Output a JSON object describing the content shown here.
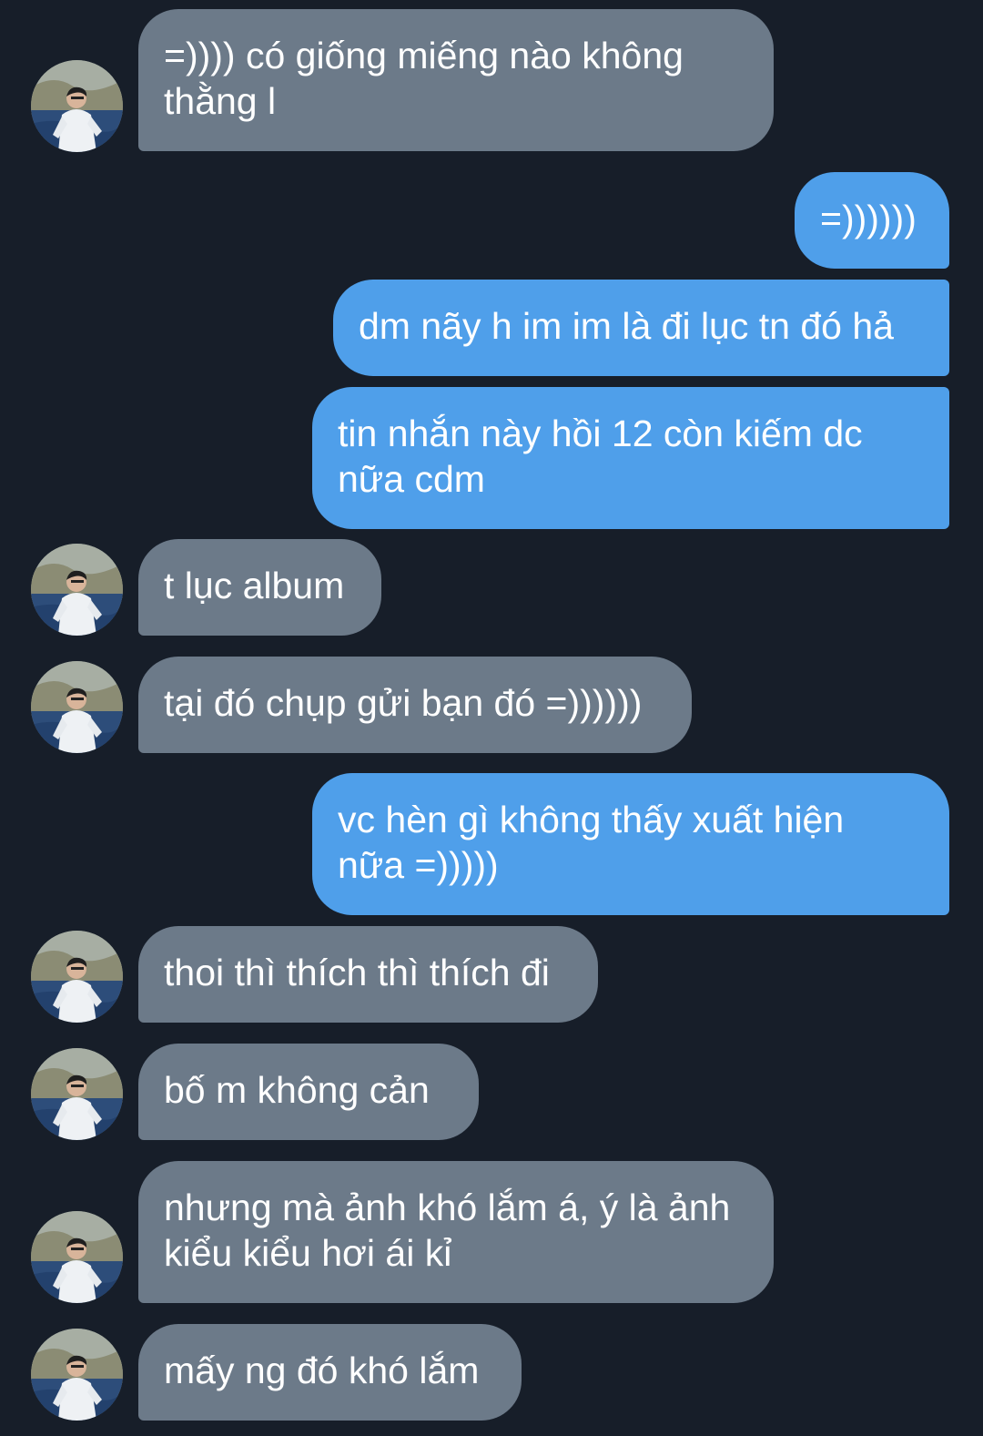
{
  "messages": [
    {
      "side": "in",
      "text": "=)))) có giống miếng nào không\nthằng l"
    },
    {
      "side": "out",
      "text": "=))))))"
    },
    {
      "side": "out",
      "text": "dm nãy h im im là đi lục tn đó hả"
    },
    {
      "side": "out",
      "text": "tin nhắn này hồi 12 còn kiếm dc\nnữa cdm"
    },
    {
      "side": "in",
      "text": "t lục album"
    },
    {
      "side": "in",
      "text": "tại đó chụp gửi bạn đó =))))))"
    },
    {
      "side": "out",
      "text": "vc hèn gì không thấy xuất hiện\nnữa =)))))"
    },
    {
      "side": "in",
      "text": "thoi thì thích thì thích đi"
    },
    {
      "side": "in",
      "text": "bố m không cản"
    },
    {
      "side": "in",
      "text": "nhưng mà ảnh khó lắm á, ý là ảnh\nkiểu kiểu hơi ái kỉ"
    },
    {
      "side": "in",
      "text": "mấy ng đó khó lắm"
    }
  ],
  "colors": {
    "background": "#171e29",
    "incoming_bubble": "#6c7a89",
    "outgoing_bubble": "#4f9fea",
    "text": "#ffffff"
  },
  "icons": {
    "avatar": "contact-avatar-photo"
  }
}
